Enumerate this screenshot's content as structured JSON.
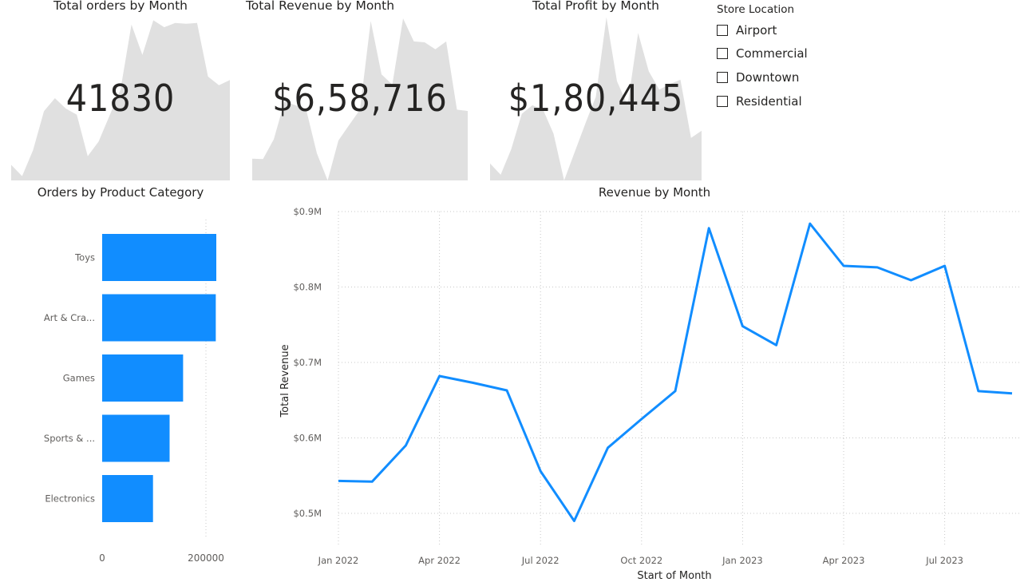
{
  "kpis": [
    {
      "title": "Total orders by Month",
      "value": "41830"
    },
    {
      "title": "Total Revenue by Month",
      "value": "$6,58,716"
    },
    {
      "title": "Total Profit by Month",
      "value": "$1,80,445"
    }
  ],
  "slicer": {
    "title": "Store Location",
    "options": [
      "Airport",
      "Commercial",
      "Downtown",
      "Residential"
    ]
  },
  "colors": {
    "bar": "#118DFF",
    "line": "#118DFF",
    "sparkline": "#E0E0E0",
    "grid": "#C8C8C8",
    "text": "#252423",
    "axis": "#605E5C"
  },
  "chart_data": [
    {
      "type": "area",
      "title": "Total orders by Month",
      "x": [
        "2022-01",
        "2022-02",
        "2022-03",
        "2022-04",
        "2022-05",
        "2022-06",
        "2022-07",
        "2022-08",
        "2022-09",
        "2022-10",
        "2022-11",
        "2022-12",
        "2023-01",
        "2023-02",
        "2023-03",
        "2023-04",
        "2023-05",
        "2023-06",
        "2023-07",
        "2023-08",
        "2023-09"
      ],
      "values": [
        1480,
        1350,
        1650,
        2100,
        2250,
        2130,
        2060,
        1580,
        1750,
        2050,
        2350,
        3100,
        2750,
        3150,
        3070,
        3120,
        3110,
        3120,
        2500,
        2400,
        2460
      ],
      "ylim": [
        1300,
        3200
      ]
    },
    {
      "type": "area",
      "title": "Total Revenue by Month",
      "x": [
        "2022-01",
        "2022-02",
        "2022-03",
        "2022-04",
        "2022-05",
        "2022-06",
        "2022-07",
        "2022-08",
        "2022-09",
        "2022-10",
        "2022-11",
        "2022-12",
        "2023-01",
        "2023-02",
        "2023-03",
        "2023-04",
        "2023-05",
        "2023-06",
        "2023-07",
        "2023-08",
        "2023-09"
      ],
      "values": [
        543,
        542,
        590,
        682,
        673,
        663,
        556,
        490,
        587,
        625,
        662,
        878,
        748,
        723,
        884,
        828,
        826,
        809,
        828,
        662,
        659
      ],
      "ylim": [
        490,
        890
      ]
    },
    {
      "type": "area",
      "title": "Total Profit by Month",
      "x": [
        "2022-01",
        "2022-02",
        "2022-03",
        "2022-04",
        "2022-05",
        "2022-06",
        "2022-07",
        "2022-08",
        "2022-09",
        "2022-10",
        "2022-11",
        "2022-12",
        "2023-01",
        "2023-02",
        "2023-03",
        "2023-04",
        "2023-05",
        "2023-06",
        "2023-07",
        "2023-08",
        "2023-09"
      ],
      "values": [
        140,
        132,
        150,
        175,
        181,
        178,
        161,
        128,
        148,
        168,
        187,
        243,
        198,
        181,
        232,
        205,
        192,
        196,
        199,
        158,
        163
      ],
      "ylim": [
        128,
        244
      ]
    },
    {
      "type": "bar",
      "orientation": "horizontal",
      "title": "Orders by Product Category",
      "categories": [
        "Toys",
        "Art & Cra...",
        "Games",
        "Sports & ...",
        "Electronics"
      ],
      "values": [
        220000,
        219000,
        156000,
        130000,
        98000
      ],
      "xlim": [
        0,
        240000
      ],
      "xticks": [
        0,
        200000
      ],
      "xtick_labels": [
        "0",
        "200000"
      ]
    },
    {
      "type": "line",
      "title": "Revenue by Month",
      "xlabel": "Start of Month",
      "ylabel": "Total Revenue",
      "x": [
        "2022-01",
        "2022-02",
        "2022-03",
        "2022-04",
        "2022-05",
        "2022-06",
        "2022-07",
        "2022-08",
        "2022-09",
        "2022-10",
        "2022-11",
        "2022-12",
        "2023-01",
        "2023-02",
        "2023-03",
        "2023-04",
        "2023-05",
        "2023-06",
        "2023-07",
        "2023-08",
        "2023-09"
      ],
      "series": [
        {
          "values": [
            543000,
            542000,
            590000,
            682000,
            673000,
            663000,
            556000,
            490000,
            587000,
            625000,
            662000,
            878000,
            748000,
            723000,
            884000,
            828000,
            826000,
            809000,
            828000,
            662000,
            659000
          ]
        }
      ],
      "ylim": [
        500000,
        900000
      ],
      "yticks": [
        500000,
        600000,
        700000,
        800000,
        900000
      ],
      "ytick_labels": [
        "$0.5M",
        "$0.6M",
        "$0.7M",
        "$0.8M",
        "$0.9M"
      ],
      "xticks": [
        "2022-01",
        "2022-04",
        "2022-07",
        "2022-10",
        "2023-01",
        "2023-04",
        "2023-07"
      ],
      "xtick_labels": [
        "Jan 2022",
        "Apr 2022",
        "Jul 2022",
        "Oct 2022",
        "Jan 2023",
        "Apr 2023",
        "Jul 2023"
      ],
      "grid": true
    }
  ]
}
